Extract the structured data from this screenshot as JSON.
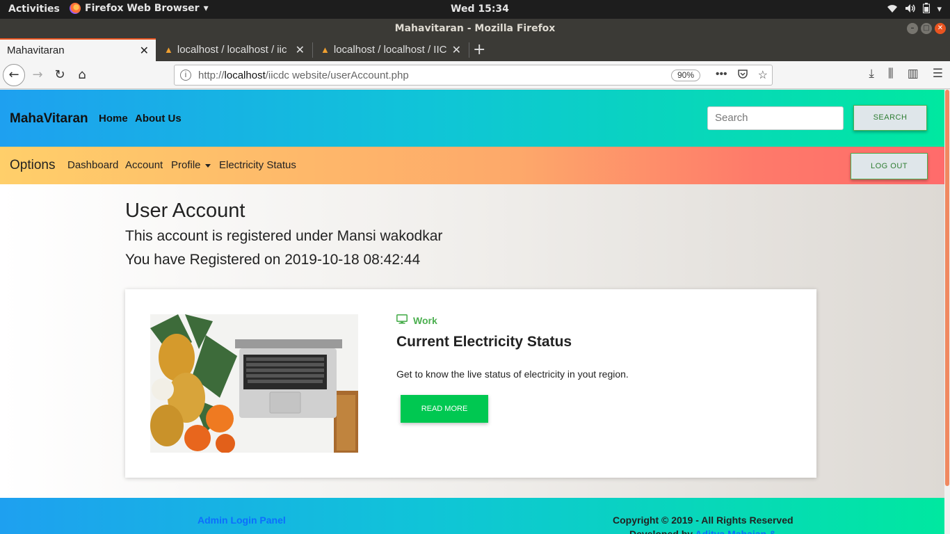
{
  "desktop": {
    "activities": "Activities",
    "app_menu": "Firefox Web Browser",
    "clock": "Wed 15:34"
  },
  "window": {
    "title": "Mahavitaran - Mozilla Firefox"
  },
  "tabs": [
    {
      "label": "Mahavitaran",
      "active": true
    },
    {
      "label": "localhost / localhost / iic",
      "active": false
    },
    {
      "label": "localhost / localhost / IIC",
      "active": false
    }
  ],
  "urlbar": {
    "prefix": "http://",
    "host": "localhost",
    "path": "/iicdc website/userAccount.php",
    "zoom": "90%"
  },
  "site": {
    "brand": "MahaVitaran",
    "nav": [
      "Home",
      "About Us"
    ],
    "search_placeholder": "Search",
    "search_button": "SEARCH"
  },
  "options_bar": {
    "title": "Options",
    "links": [
      "Dashboard",
      "Account",
      "Profile",
      "Electricity Status"
    ],
    "logout": "LOG OUT"
  },
  "account": {
    "title": "User Account",
    "registered_under": "This account is registered under Mansi wakodkar",
    "registered_on": "You have Registered on 2019-10-18 08:42:44"
  },
  "card": {
    "tag": "Work",
    "title": "Current Electricity Status",
    "description": "Get to know the live status of electricity in yout region.",
    "button": "READ MORE"
  },
  "footer": {
    "admin_link": "Admin Login Panel",
    "copyright": "Copyright © 2019 - All Rights Reserved",
    "developed_prefix": "Developed by",
    "developed_name": "Aditya Mahajan &"
  },
  "colors": {
    "header_gradient": [
      "#1ea0f0",
      "#00e8a0"
    ],
    "options_gradient": [
      "#ffcf6a",
      "#ff6b6b"
    ],
    "accent_green": "#00c851",
    "link_blue": "#0d6efd"
  }
}
